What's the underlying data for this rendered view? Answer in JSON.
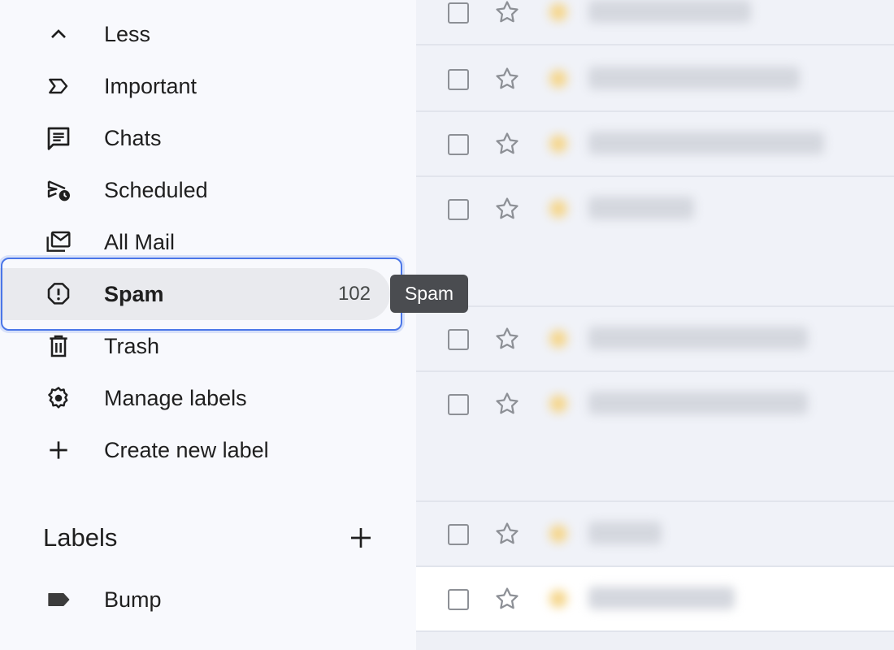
{
  "sidebar": {
    "items": [
      {
        "label": "Less",
        "icon": "chevron-up-icon",
        "count": ""
      },
      {
        "label": "Important",
        "icon": "label-important-icon",
        "count": ""
      },
      {
        "label": "Chats",
        "icon": "chat-icon",
        "count": ""
      },
      {
        "label": "Scheduled",
        "icon": "schedule-send-icon",
        "count": ""
      },
      {
        "label": "All Mail",
        "icon": "all-mail-icon",
        "count": ""
      },
      {
        "label": "Spam",
        "icon": "spam-icon",
        "count": "102",
        "active": true
      },
      {
        "label": "Trash",
        "icon": "trash-icon",
        "count": ""
      },
      {
        "label": "Manage labels",
        "icon": "gear-icon",
        "count": ""
      },
      {
        "label": "Create new label",
        "icon": "plus-icon",
        "count": ""
      }
    ],
    "labels_header": "Labels",
    "user_labels": [
      {
        "label": "Bump",
        "icon": "label-icon"
      }
    ]
  },
  "tooltip": {
    "text": "Spam"
  },
  "colors": {
    "sidebar_bg": "#f8f9fd",
    "active_bg": "#e9eaee",
    "focus_ring": "#4a76e8",
    "tooltip_bg": "#4a4c50",
    "star_color": "#8d9096"
  }
}
